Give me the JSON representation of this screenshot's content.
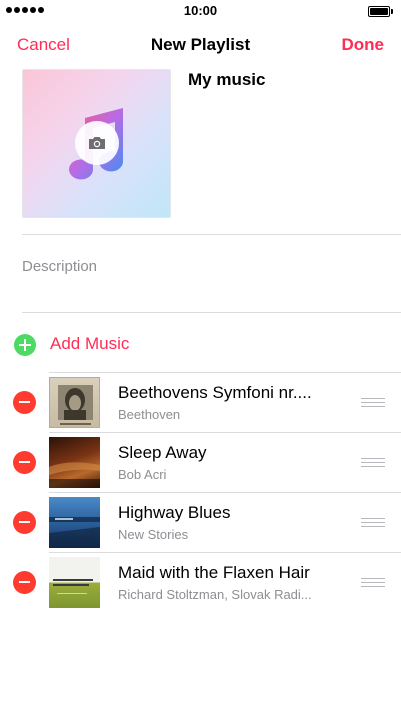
{
  "status_bar": {
    "time": "10:00"
  },
  "nav": {
    "cancel": "Cancel",
    "title": "New Playlist",
    "done": "Done"
  },
  "playlist": {
    "name": "My music",
    "description_placeholder": "Description"
  },
  "add_music": {
    "label": "Add Music"
  },
  "colors": {
    "accent": "#ff2d55",
    "add": "#4cd964",
    "remove": "#ff3b30",
    "secondary_text": "#8e8e93"
  },
  "tracks": [
    {
      "title": "Beethovens Symfoni nr....",
      "artist": "Beethoven"
    },
    {
      "title": "Sleep Away",
      "artist": "Bob Acri"
    },
    {
      "title": "Highway Blues",
      "artist": "New Stories"
    },
    {
      "title": "Maid with the Flaxen Hair",
      "artist": "Richard Stoltzman, Slovak Radi..."
    }
  ],
  "icons": {
    "signal": "signal-dots-icon",
    "battery": "battery-icon",
    "camera": "camera-icon",
    "music_note": "music-note-icon",
    "add": "plus-circle-icon",
    "remove": "minus-circle-icon",
    "reorder": "reorder-grabber-icon"
  }
}
